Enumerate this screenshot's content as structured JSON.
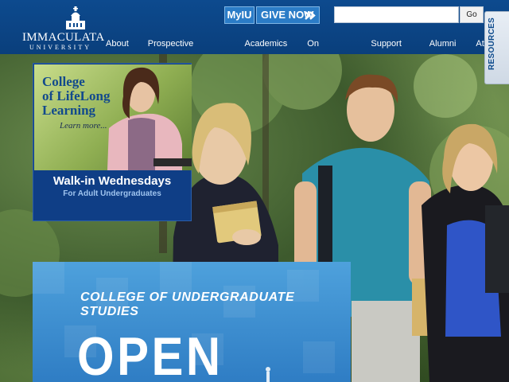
{
  "logo": {
    "name": "IMMACULATA",
    "sub": "UNIVERSITY"
  },
  "header": {
    "myiu_label": "MyIU",
    "give_label": "GIVE NOW",
    "search_placeholder": "",
    "search_button": "Go"
  },
  "nav": {
    "items": [
      {
        "label": "About"
      },
      {
        "label": "Prospective Students"
      },
      {
        "label": "Academics"
      },
      {
        "label": "On Campus"
      },
      {
        "label": "Support IU"
      },
      {
        "label": "Alumni"
      },
      {
        "label": "Athletics"
      }
    ]
  },
  "resources_tab": {
    "label": "RESOURCES"
  },
  "promo": {
    "title_lines": [
      "College",
      "of LifeLong",
      "Learning"
    ],
    "learn_more": "Learn more...",
    "caption": "Walk-in Wednesdays",
    "subcaption": "For Adult Undergraduates"
  },
  "undergrad": {
    "title": "COLLEGE OF UNDERGRADUATE STUDIES",
    "big_text": "OPEN"
  },
  "colors": {
    "header_blue": "#0d4a8e",
    "button_blue": "#2b7cc7",
    "promo_blue": "#0f3e86",
    "panel_blue": "#3a8ed2"
  },
  "icons": {
    "logo": "chapel-dome-icon",
    "give_arrows": "double-chevron-right-icon"
  }
}
